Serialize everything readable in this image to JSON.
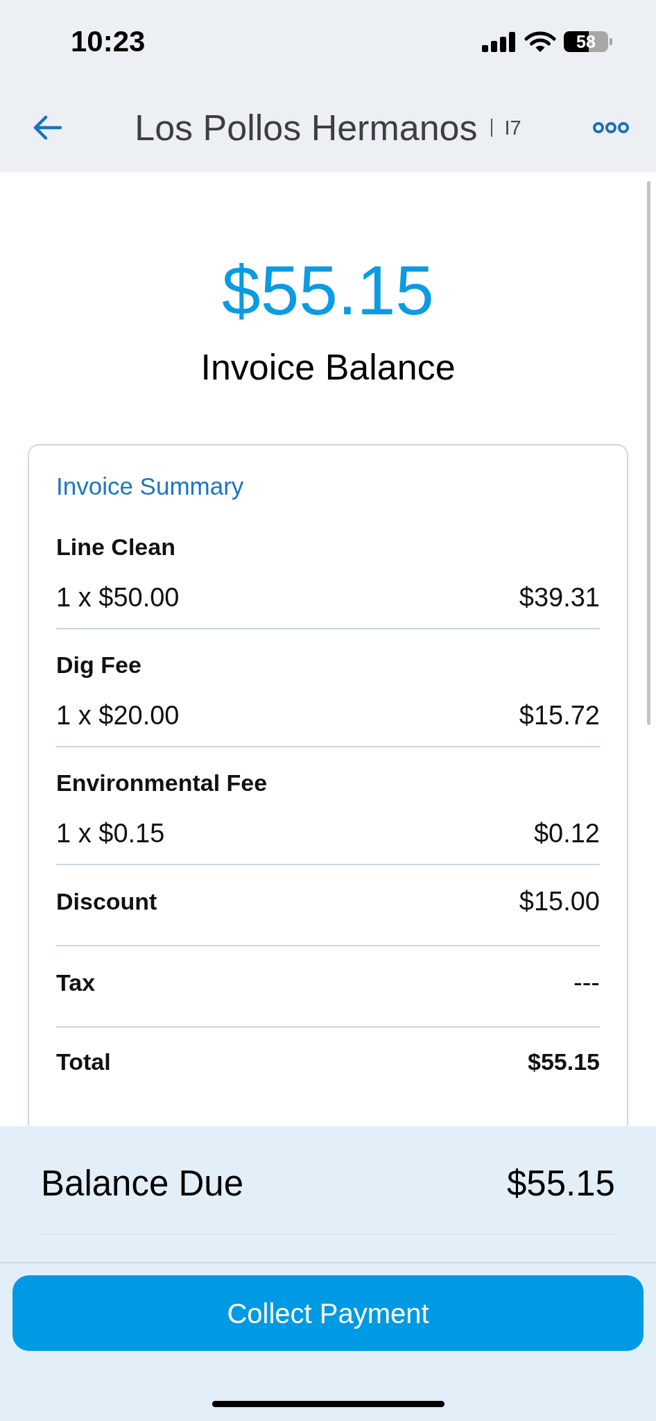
{
  "status_bar": {
    "time": "10:23",
    "battery": "58"
  },
  "header": {
    "title": "Los Pollos Hermanos",
    "code": "I7"
  },
  "balance": {
    "amount": "$55.15",
    "label": "Invoice Balance"
  },
  "invoice_summary": {
    "title": "Invoice Summary",
    "rows": [
      {
        "kind": "line_item",
        "name": "Line Clean",
        "quantity_price": "1 x $50.00",
        "amount": "$39.31"
      },
      {
        "kind": "line_item",
        "name": "Dig Fee",
        "quantity_price": "1 x $20.00",
        "amount": "$15.72"
      },
      {
        "kind": "line_item",
        "name": "Environmental Fee",
        "quantity_price": "1 x $0.15",
        "amount": "$0.12"
      },
      {
        "kind": "adjustment",
        "label": "Discount",
        "value": "$15.00"
      },
      {
        "kind": "adjustment",
        "label": "Tax",
        "value": "---"
      },
      {
        "kind": "total",
        "label": "Total",
        "value": "$55.15"
      }
    ]
  },
  "balance_due": {
    "label": "Balance Due",
    "value": "$55.15"
  },
  "collect_button": {
    "label": "Collect Payment"
  }
}
